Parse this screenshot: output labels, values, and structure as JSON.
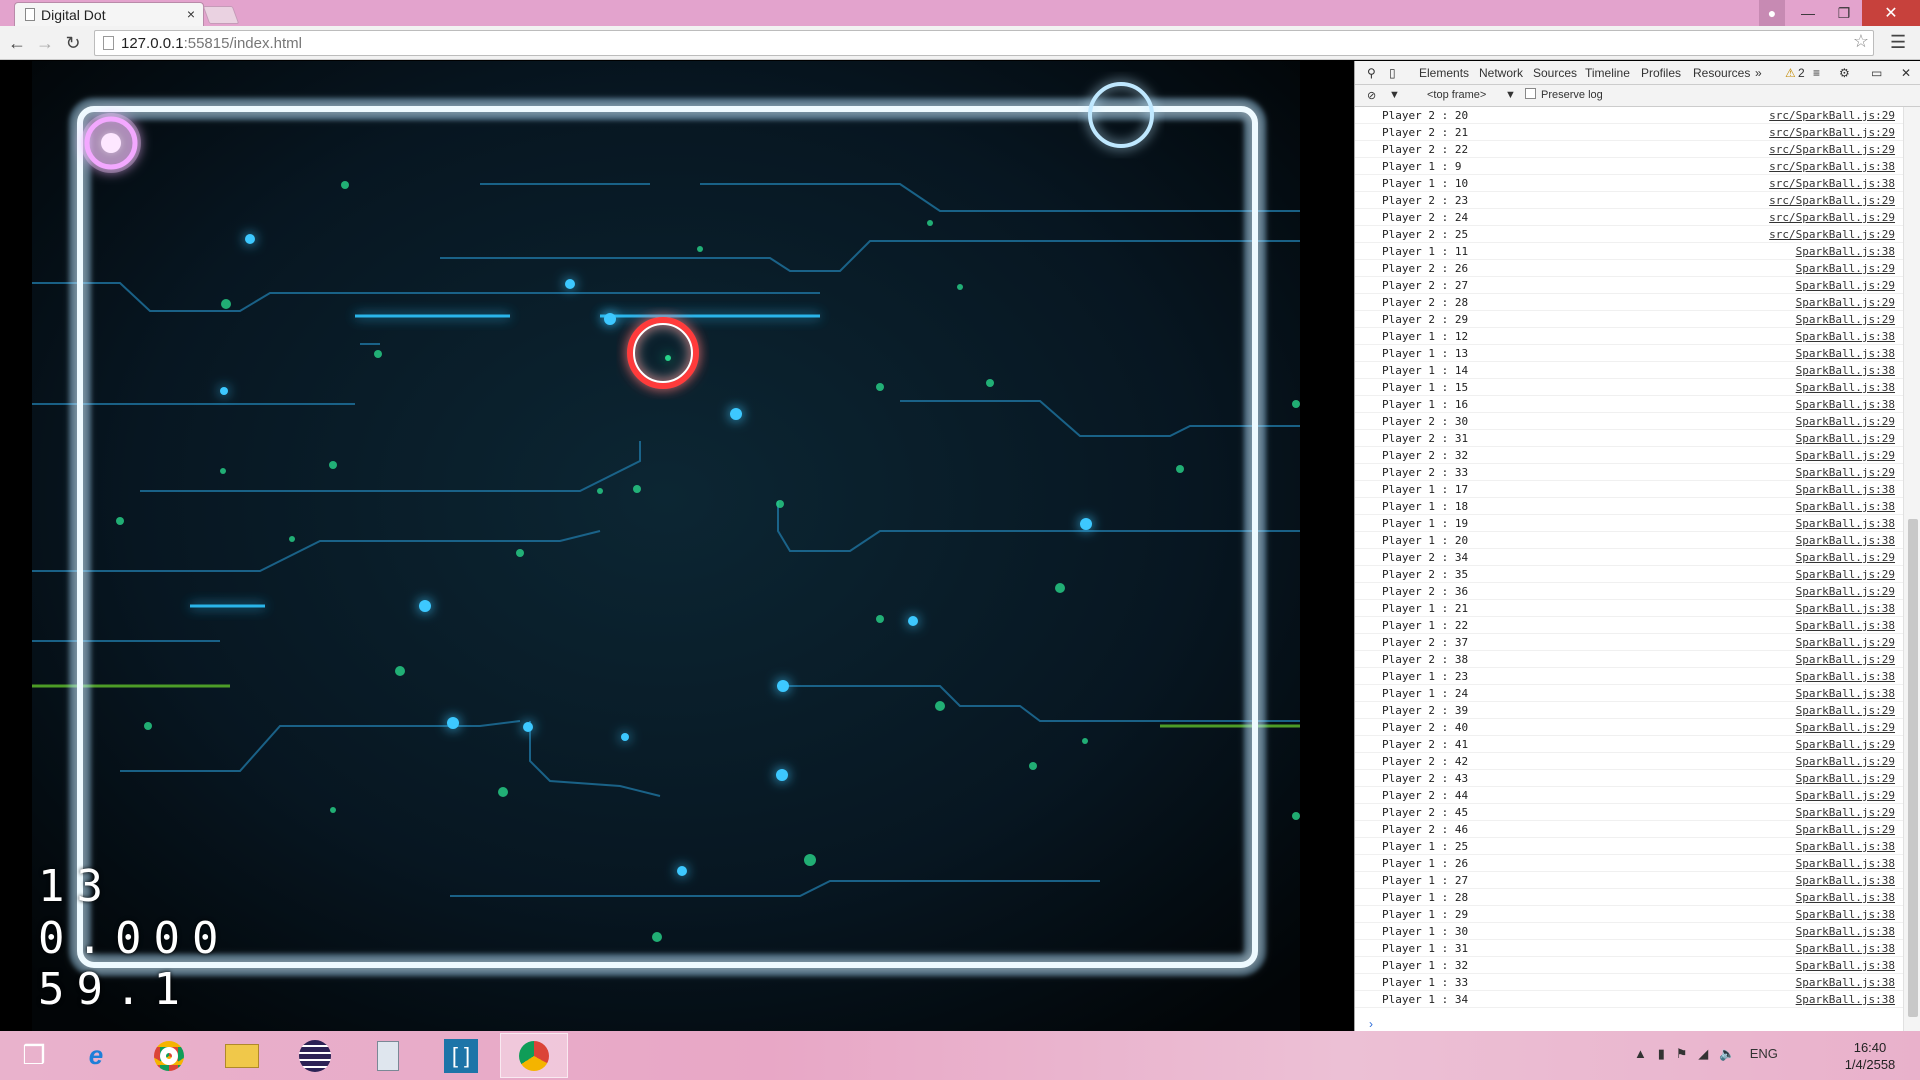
{
  "window": {
    "tab_title": "Digital Dot",
    "tab_close": "×",
    "url_host": "127.0.0.1",
    "url_rest": ":55815/index.html"
  },
  "hud": {
    "line1": "13",
    "line2": "0.000",
    "line3": "59.1"
  },
  "devtools": {
    "tabs": [
      "Elements",
      "Network",
      "Sources",
      "Timeline",
      "Profiles",
      "Resources"
    ],
    "more": "»",
    "warnings": "2",
    "frame": "<top frame>",
    "preserve_log": "Preserve log",
    "console": [
      {
        "msg": "Player 2 : 20",
        "src": "src/SparkBall.js:29"
      },
      {
        "msg": "Player 2 : 21",
        "src": "src/SparkBall.js:29"
      },
      {
        "msg": "Player 2 : 22",
        "src": "src/SparkBall.js:29"
      },
      {
        "msg": "Player 1 : 9",
        "src": "src/SparkBall.js:38"
      },
      {
        "msg": "Player 1 : 10",
        "src": "src/SparkBall.js:38"
      },
      {
        "msg": "Player 2 : 23",
        "src": "src/SparkBall.js:29"
      },
      {
        "msg": "Player 2 : 24",
        "src": "src/SparkBall.js:29"
      },
      {
        "msg": "Player 2 : 25",
        "src": "src/SparkBall.js:29"
      },
      {
        "msg": "Player 1 : 11",
        "src": "SparkBall.js:38"
      },
      {
        "msg": "Player 2 : 26",
        "src": "SparkBall.js:29"
      },
      {
        "msg": "Player 2 : 27",
        "src": "SparkBall.js:29"
      },
      {
        "msg": "Player 2 : 28",
        "src": "SparkBall.js:29"
      },
      {
        "msg": "Player 2 : 29",
        "src": "SparkBall.js:29"
      },
      {
        "msg": "Player 1 : 12",
        "src": "SparkBall.js:38"
      },
      {
        "msg": "Player 1 : 13",
        "src": "SparkBall.js:38"
      },
      {
        "msg": "Player 1 : 14",
        "src": "SparkBall.js:38"
      },
      {
        "msg": "Player 1 : 15",
        "src": "SparkBall.js:38"
      },
      {
        "msg": "Player 1 : 16",
        "src": "SparkBall.js:38"
      },
      {
        "msg": "Player 2 : 30",
        "src": "SparkBall.js:29"
      },
      {
        "msg": "Player 2 : 31",
        "src": "SparkBall.js:29"
      },
      {
        "msg": "Player 2 : 32",
        "src": "SparkBall.js:29"
      },
      {
        "msg": "Player 2 : 33",
        "src": "SparkBall.js:29"
      },
      {
        "msg": "Player 1 : 17",
        "src": "SparkBall.js:38"
      },
      {
        "msg": "Player 1 : 18",
        "src": "SparkBall.js:38"
      },
      {
        "msg": "Player 1 : 19",
        "src": "SparkBall.js:38"
      },
      {
        "msg": "Player 1 : 20",
        "src": "SparkBall.js:38"
      },
      {
        "msg": "Player 2 : 34",
        "src": "SparkBall.js:29"
      },
      {
        "msg": "Player 2 : 35",
        "src": "SparkBall.js:29"
      },
      {
        "msg": "Player 2 : 36",
        "src": "SparkBall.js:29"
      },
      {
        "msg": "Player 1 : 21",
        "src": "SparkBall.js:38"
      },
      {
        "msg": "Player 1 : 22",
        "src": "SparkBall.js:38"
      },
      {
        "msg": "Player 2 : 37",
        "src": "SparkBall.js:29"
      },
      {
        "msg": "Player 2 : 38",
        "src": "SparkBall.js:29"
      },
      {
        "msg": "Player 1 : 23",
        "src": "SparkBall.js:38"
      },
      {
        "msg": "Player 1 : 24",
        "src": "SparkBall.js:38"
      },
      {
        "msg": "Player 2 : 39",
        "src": "SparkBall.js:29"
      },
      {
        "msg": "Player 2 : 40",
        "src": "SparkBall.js:29"
      },
      {
        "msg": "Player 2 : 41",
        "src": "SparkBall.js:29"
      },
      {
        "msg": "Player 2 : 42",
        "src": "SparkBall.js:29"
      },
      {
        "msg": "Player 2 : 43",
        "src": "SparkBall.js:29"
      },
      {
        "msg": "Player 2 : 44",
        "src": "SparkBall.js:29"
      },
      {
        "msg": "Player 2 : 45",
        "src": "SparkBall.js:29"
      },
      {
        "msg": "Player 2 : 46",
        "src": "SparkBall.js:29"
      },
      {
        "msg": "Player 1 : 25",
        "src": "SparkBall.js:38"
      },
      {
        "msg": "Player 1 : 26",
        "src": "SparkBall.js:38"
      },
      {
        "msg": "Player 1 : 27",
        "src": "SparkBall.js:38"
      },
      {
        "msg": "Player 1 : 28",
        "src": "SparkBall.js:38"
      },
      {
        "msg": "Player 1 : 29",
        "src": "SparkBall.js:38"
      },
      {
        "msg": "Player 1 : 30",
        "src": "SparkBall.js:38"
      },
      {
        "msg": "Player 1 : 31",
        "src": "SparkBall.js:38"
      },
      {
        "msg": "Player 1 : 32",
        "src": "SparkBall.js:38"
      },
      {
        "msg": "Player 1 : 33",
        "src": "SparkBall.js:38"
      },
      {
        "msg": "Player 1 : 34",
        "src": "SparkBall.js:38"
      }
    ],
    "prompt": "›"
  },
  "taskbar": {
    "apps": [
      "start-icon",
      "internet-explorer-icon",
      "chrome-icon",
      "file-explorer-icon",
      "eclipse-icon",
      "calculator-icon",
      "brackets-icon",
      "chrome-icon"
    ],
    "language": "ENG",
    "time": "16:40",
    "date": "1/4/2558"
  },
  "colors": {
    "titlebar": "#e3a3cd",
    "frame_glow": "#bfe8ff",
    "player_ring": "#ff3b3b",
    "corner_pink": "#f3a8ff"
  }
}
